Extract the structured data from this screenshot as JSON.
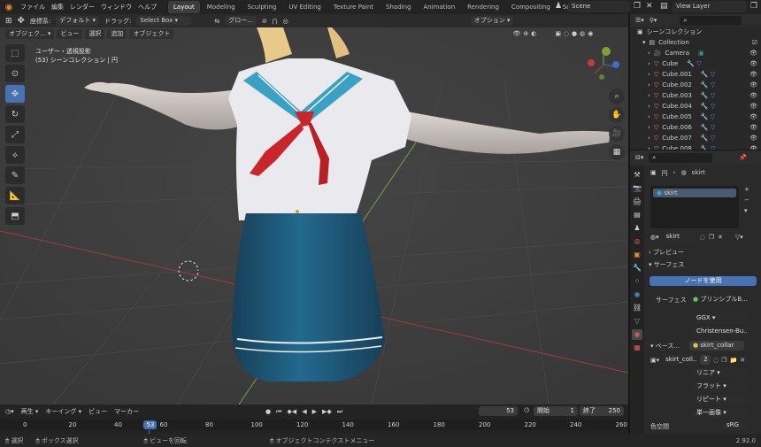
{
  "topbar": {
    "menu": [
      "ファイル",
      "編集",
      "レンダー",
      "ウィンドウ",
      "ヘルプ"
    ],
    "workspaces": [
      "Layout",
      "Modeling",
      "Sculpting",
      "UV Editing",
      "Texture Paint",
      "Shading",
      "Animation",
      "Rendering",
      "Compositing",
      "Scripting"
    ],
    "active_workspace": "Layout",
    "scene": "Scene",
    "view_layer": "View Layer"
  },
  "tool_header": {
    "coord_label": "座標系:",
    "coord_value": "デフォルト",
    "drag_label": "ドラッグ:",
    "drag_value": "Select Box",
    "pivot_value": "グロー...",
    "options": "オプション"
  },
  "viewport_header": {
    "mode": "オブジェク...",
    "menus": [
      "ビュー",
      "選択",
      "追加",
      "オブジェクト"
    ]
  },
  "viewport": {
    "line1": "ユーザー・透視投影",
    "line2": "(53) シーンコレクション | 円"
  },
  "outliner": {
    "title": "シーンコレクション",
    "collection": "Collection",
    "items": [
      "Camera",
      "Cube",
      "Cube.001",
      "Cube.002",
      "Cube.003",
      "Cube.004",
      "Cube.005",
      "Cube.006",
      "Cube.007",
      "Cube.008"
    ]
  },
  "properties": {
    "breadcrumb_obj": "円",
    "breadcrumb_mat": "skirt",
    "slot": "skirt",
    "material_name": "skirt",
    "preview": "プレビュー",
    "surface_panel": "サーフェス",
    "use_nodes": "ノードを使用",
    "surface_label": "サーフェス",
    "surface_value": "プリンシプルB...",
    "distribution": "GGX",
    "subsurface": "Christensen-Bu...",
    "base_label": "ベース...",
    "base_value": "skirt_collar",
    "image_name": "skirt_coll...",
    "image_users": "2",
    "interp": "リニア",
    "projection": "フラット",
    "extension": "リピート",
    "source": "単一画像",
    "colorspace_label": "色空間",
    "colorspace_value": "sRG"
  },
  "timeline": {
    "menus": [
      "再生",
      "キーイング",
      "ビュー",
      "マーカー"
    ],
    "current_frame": "53",
    "start_label": "開始",
    "start": "1",
    "end_label": "終了",
    "end": "250",
    "ruler": [
      "0",
      "20",
      "40",
      "53",
      "60",
      "80",
      "100",
      "120",
      "140",
      "160",
      "180",
      "200",
      "220",
      "240",
      "260"
    ]
  },
  "statusbar": {
    "select": "選択",
    "box_select": "ボックス選択",
    "rotate_view": "ビューを回転",
    "context_menu": "オブジェクトコンテクストメニュー",
    "version": "2.92.0"
  },
  "colors": {
    "accent": "#4772b3",
    "orange": "#e88a2d",
    "skirt": "#1f5f80",
    "sailor_collar": "#3aa0c4",
    "scarf": "#c8262a"
  }
}
